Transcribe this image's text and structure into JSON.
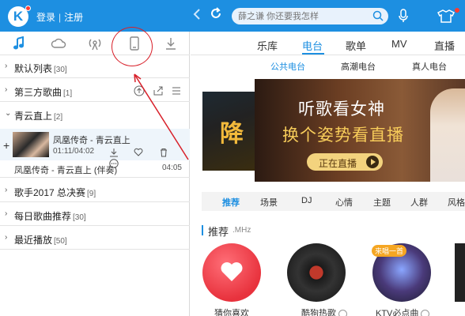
{
  "header": {
    "logo": "K",
    "login_label": "登录",
    "register_label": "注册",
    "separator": "|",
    "search_placeholder": "薛之谦 你还要我怎样"
  },
  "left_panel": {
    "tabs": [
      "music-note-icon",
      "cloud-icon",
      "radio-icon",
      "phone-icon",
      "download-icon"
    ],
    "lists": [
      {
        "name": "默认列表",
        "count": "[30]",
        "expanded": false
      },
      {
        "name": "第三方歌曲",
        "count": "[1]",
        "expanded": false
      },
      {
        "name": "青云直上",
        "count": "[2]",
        "expanded": true
      },
      {
        "name": "歌手2017 总决赛",
        "count": "[9]",
        "expanded": false
      },
      {
        "name": "每日歌曲推荐",
        "count": "[30]",
        "expanded": false
      },
      {
        "name": "最近播放",
        "count": "[50]",
        "expanded": false
      }
    ],
    "current_song": {
      "title": "凤凰传奇 - 青云直上",
      "time": "01:11/04:02"
    },
    "second_song": {
      "title": "凤凰传奇 - 青云直上 (伴奏)",
      "duration": "04:05"
    }
  },
  "right_panel": {
    "main_tabs": [
      "乐库",
      "电台",
      "歌单",
      "MV",
      "直播"
    ],
    "active_main_tab": "电台",
    "sub_tabs": [
      "公共电台",
      "高潮电台",
      "真人电台"
    ],
    "banner": {
      "side_text": "降",
      "title": "听歌看女神",
      "subtitle": "换个姿势看直播",
      "button": "正在直播"
    },
    "categories": [
      "推荐",
      "场景",
      "DJ",
      "心情",
      "主题",
      "人群",
      "风格"
    ],
    "section_title": "推荐",
    "section_sub": ".MHz",
    "stations": [
      {
        "label": "猜你喜欢"
      },
      {
        "label": "酷狗热歌"
      },
      {
        "label": "KTV必点曲",
        "badge": "来唱一首"
      }
    ]
  },
  "colors": {
    "accent": "#1d8fe1",
    "annotation": "#d8202a"
  }
}
